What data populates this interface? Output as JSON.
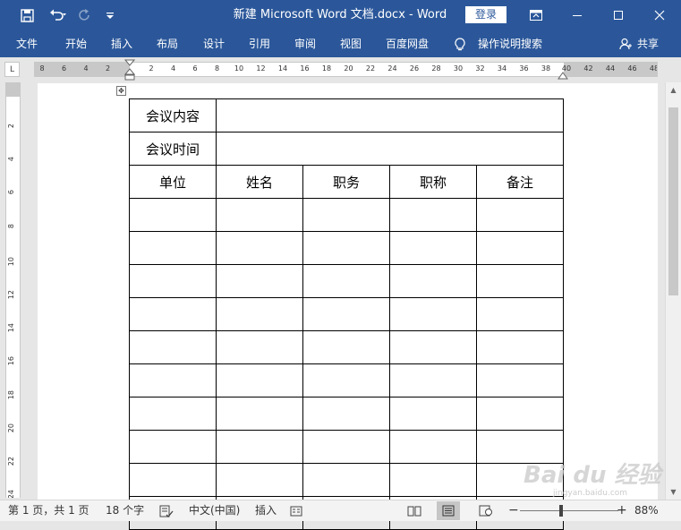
{
  "titlebar": {
    "title": "新建 Microsoft Word 文档.docx  -  Word",
    "login": "登录"
  },
  "ribbon": {
    "tabs": [
      "文件",
      "开始",
      "插入",
      "布局",
      "设计",
      "引用",
      "审阅",
      "视图",
      "百度网盘"
    ],
    "tellme": "操作说明搜索",
    "share": "共享"
  },
  "ruler": {
    "left_ticks": [
      "8",
      "6",
      "4",
      "2"
    ],
    "main_ticks": [
      "2",
      "4",
      "6",
      "8",
      "10",
      "12",
      "14",
      "16",
      "18",
      "20",
      "22",
      "24",
      "26",
      "28",
      "30",
      "32",
      "34",
      "36",
      "38"
    ],
    "right_ticks": [
      "40",
      "42",
      "44",
      "46",
      "48"
    ],
    "vertical_ticks": [
      "2",
      "4",
      "6",
      "8",
      "10",
      "12",
      "14",
      "16",
      "18",
      "20",
      "22",
      "24"
    ]
  },
  "table": {
    "row1_label": "会议内容",
    "row2_label": "会议时间",
    "headers": [
      "单位",
      "姓名",
      "职务",
      "职称",
      "备注"
    ],
    "empty_rows": 10
  },
  "statusbar": {
    "page": "第 1 页，共 1 页",
    "words": "18 个字",
    "language": "中文(中国)",
    "mode": "插入",
    "zoom": "88%"
  },
  "watermark": {
    "text": "Bai du 经验",
    "sub": "jingyan.baidu.com"
  },
  "colors": {
    "title_bar": "#2b579a",
    "page": "#ffffff",
    "workspace": "#e6e6e6"
  }
}
